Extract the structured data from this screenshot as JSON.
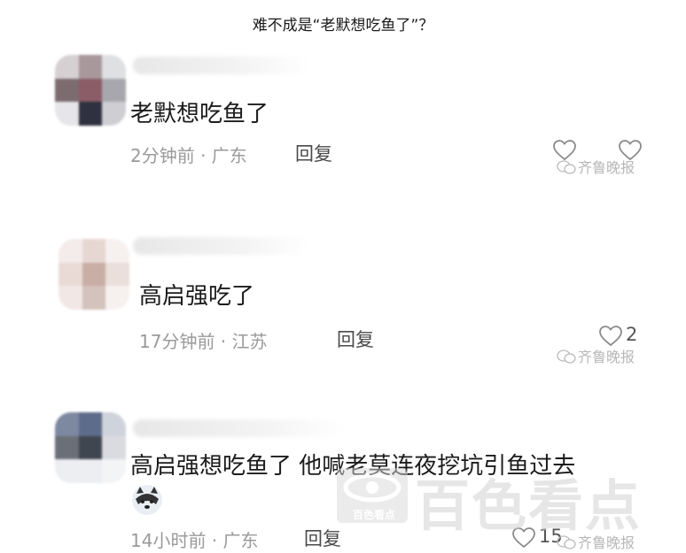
{
  "headline": "难不成是“老默想吃鱼了”？",
  "comments": [
    {
      "text": "老默想吃鱼了",
      "time_location": "2分钟前 · 广东",
      "reply_label": "回复",
      "likes": "",
      "avatar_colors": [
        "#d6d0d2",
        "#a8989c",
        "#dfe0e2",
        "#7c6c70",
        "#8b5d66",
        "#a7a7ad",
        "#e6e6e8",
        "#2f3140",
        "#cfcfd3"
      ]
    },
    {
      "text": "高启强吃了",
      "time_location": "17分钟前 · 江苏",
      "reply_label": "回复",
      "likes": "2",
      "avatar_colors": [
        "#f4eceb",
        "#e7d7d2",
        "#f6f1ef",
        "#eadad5",
        "#c9aea6",
        "#eadfdb",
        "#f1e8e5",
        "#d4c2bc",
        "#f6f1ef"
      ]
    },
    {
      "text": "高启强想吃鱼了  他喊老莫连夜挖坑引鱼过去",
      "time_location": "14小时前 · 广东",
      "reply_label": "回复",
      "likes": "15",
      "avatar_colors": [
        "#7d88a1",
        "#5d6c8a",
        "#cfd3db",
        "#6b6f78",
        "#404650",
        "#d9dbe0",
        "#eceef2",
        "#eceef2",
        "#f3f4f6"
      ]
    }
  ],
  "watermark": "齐鲁晚报",
  "brand": {
    "logo_text": "百色看点",
    "name": "百色看点"
  }
}
